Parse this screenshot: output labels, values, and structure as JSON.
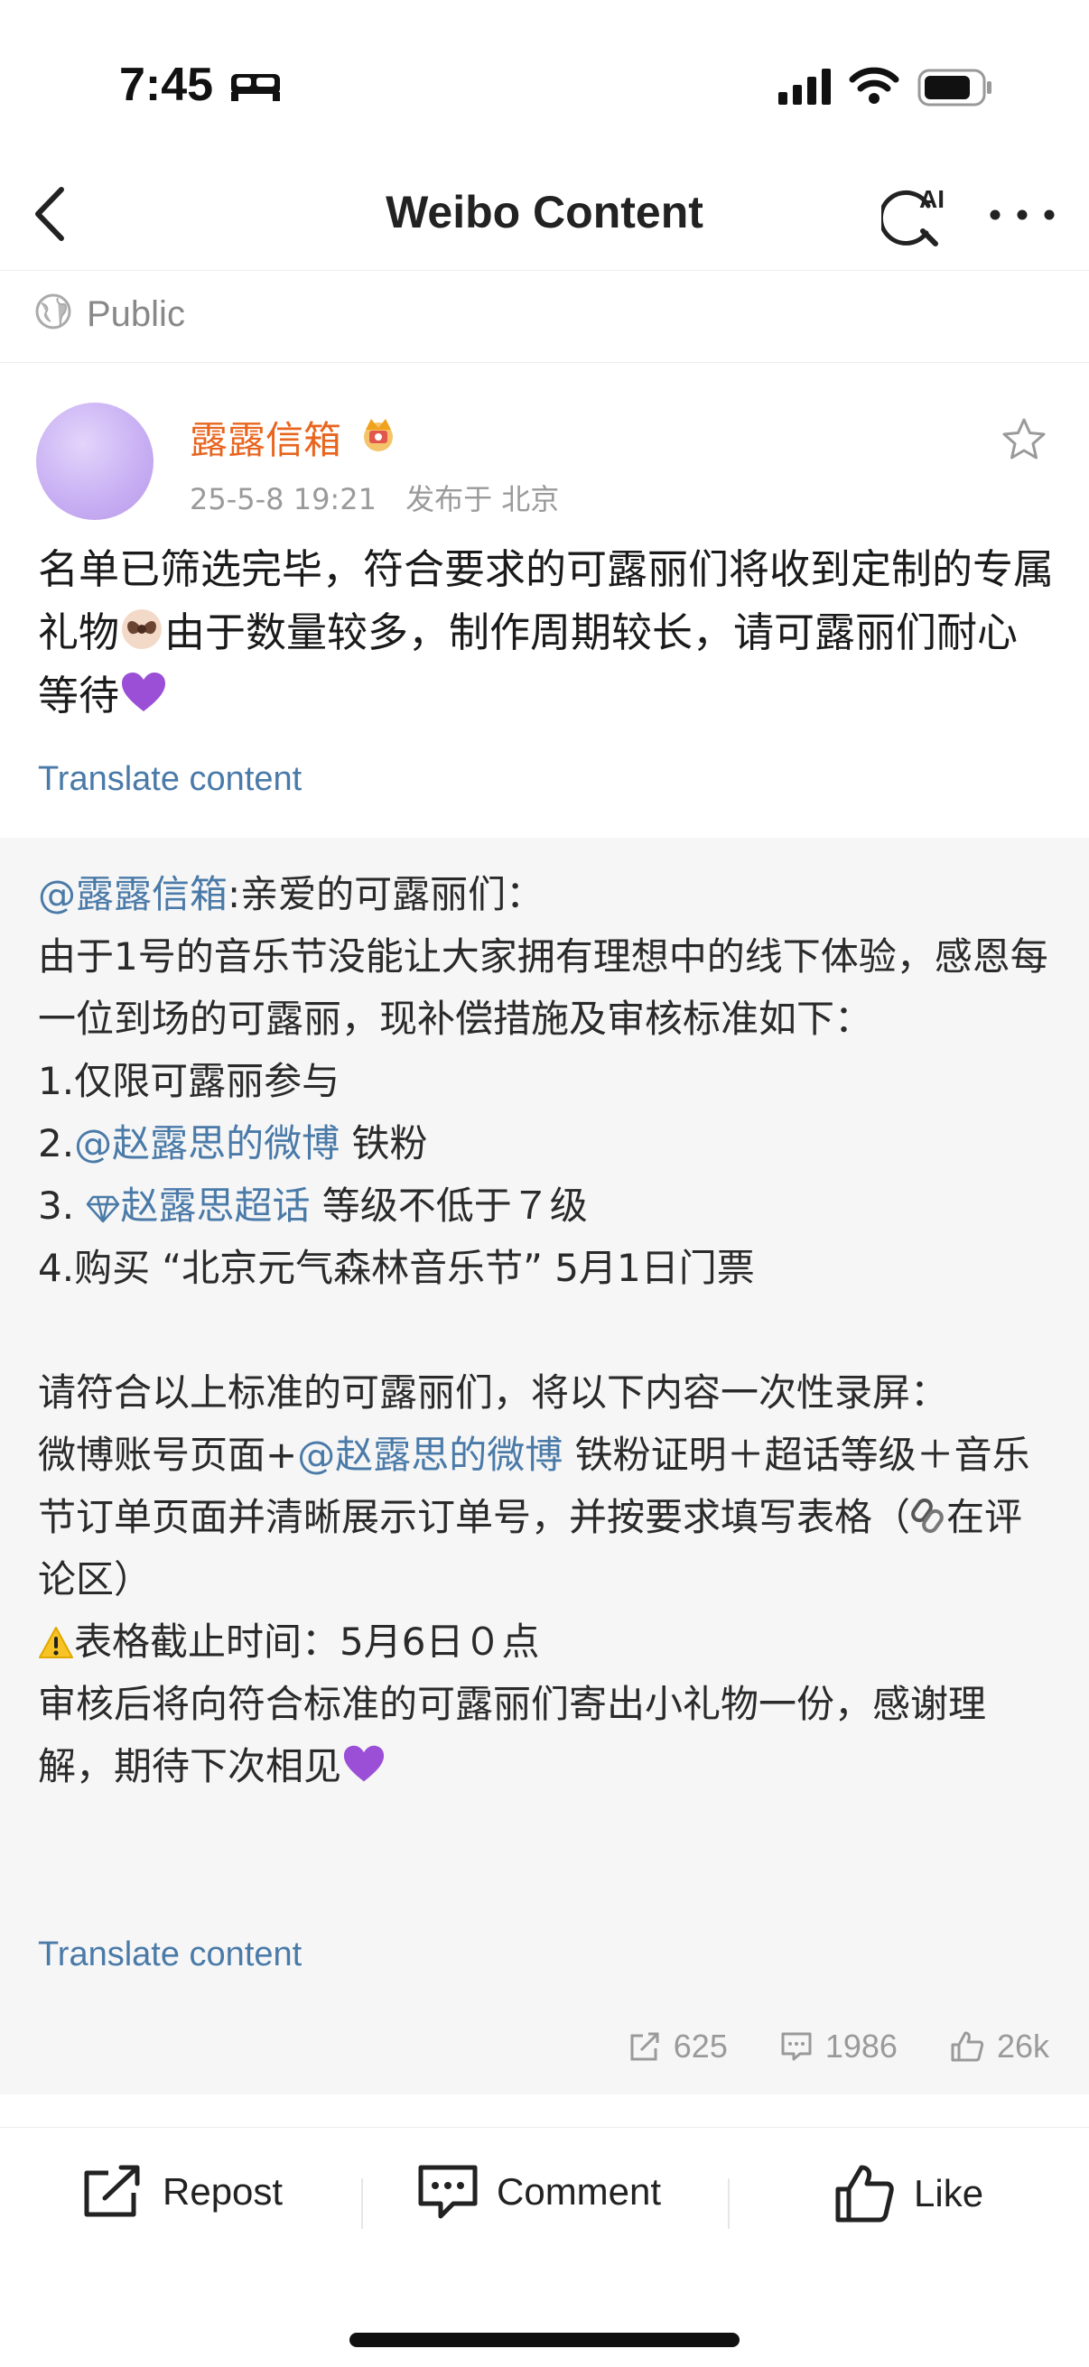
{
  "status_bar": {
    "time": "7:45",
    "icons": [
      "bed-icon",
      "signal-icon",
      "wifi-icon",
      "battery-icon"
    ]
  },
  "nav": {
    "title": "Weibo Content",
    "icons": [
      "back-icon",
      "ai-search-icon",
      "more-icon"
    ],
    "ai_badge": "AI"
  },
  "visibility": {
    "label": "Public",
    "icon": "globe-icon"
  },
  "post": {
    "author_name": "露露信箱",
    "date": "25-5-8 19:21",
    "location": "发布于 北京",
    "text_part1": "名单已筛选完毕，符合要求的可露丽们将收到定制的专属礼物",
    "text_part2": "由于数量较多，制作周期较长，请可露丽们耐心等待",
    "translate_label": "Translate content"
  },
  "repost": {
    "author_mention": "@露露信箱",
    "intro": ":亲爱的可露丽们：",
    "line_1": "由于1号的音乐节没能让大家拥有理想中的线下体验，感恩每一位到场的可露丽，现补偿措施及审核标准如下：",
    "item_1": "1.仅限可露丽参与",
    "item_2_prefix": "2.",
    "item_2_mention": "@赵露思的微博",
    "item_2_suffix": " 铁粉",
    "item_3_prefix": "3. ",
    "item_3_topic": "赵露思超话",
    "item_3_suffix": " 等级不低于７级",
    "item_4": "4.购买 “北京元气森林音乐节” 5月1日门票",
    "para_2": "请符合以上标准的可露丽们，将以下内容一次性录屏：",
    "para_3_prefix": "微博账号页面+",
    "para_3_mention": "@赵露思的微博",
    "para_3_suffix": " 铁粉证明＋超话等级＋音乐节订单页面并清晰展示订单号，并按要求填写表格（",
    "para_3_end": "在评论区）",
    "deadline": "表格截止时间：5月6日０点",
    "closing": "审核后将向符合标准的可露丽们寄出小礼物一份，感谢理解，期待下次相见",
    "translate_label": "Translate content",
    "stats": {
      "reposts": "625",
      "comments": "1986",
      "likes": "26k"
    }
  },
  "actions": {
    "repost": "Repost",
    "comment": "Comment",
    "like": "Like"
  },
  "colors": {
    "author_orange": "#e8651f",
    "link_blue": "#4a7aa8",
    "heart_purple": "#9b4fd6",
    "repost_bg": "#f6f6f6"
  }
}
